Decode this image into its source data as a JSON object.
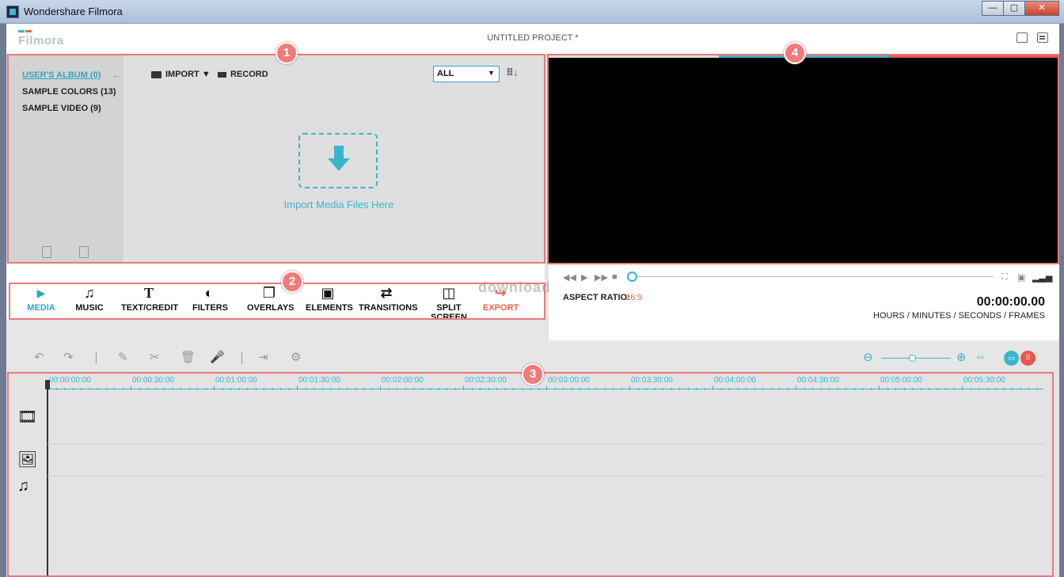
{
  "window": {
    "title": "Wondershare Filmora",
    "min": "—",
    "max": "▢",
    "close": "✕"
  },
  "app": {
    "logo_text": "Filmora",
    "project_title": "UNTITLED PROJECT *"
  },
  "library": {
    "albums": [
      {
        "label": "USER'S ALBUM (0)",
        "active": true
      },
      {
        "label": "SAMPLE COLORS (13)",
        "active": false
      },
      {
        "label": "SAMPLE VIDEO (9)",
        "active": false
      }
    ],
    "import_label": "IMPORT ▼",
    "record_label": "RECORD",
    "filter_value": "ALL",
    "drop_text": "Import Media Files Here"
  },
  "categories": [
    {
      "label": "MEDIA",
      "icon": "media-icon",
      "glyph": "▶",
      "active": true
    },
    {
      "label": "MUSIC",
      "icon": "music-icon",
      "glyph": "♫"
    },
    {
      "label": "TEXT/CREDIT",
      "icon": "text-icon",
      "glyph": "T"
    },
    {
      "label": "FILTERS",
      "icon": "filters-icon",
      "glyph": "◐"
    },
    {
      "label": "OVERLAYS",
      "icon": "overlays-icon",
      "glyph": "❐"
    },
    {
      "label": "ELEMENTS",
      "icon": "elements-icon",
      "glyph": "▣"
    },
    {
      "label": "TRANSITIONS",
      "icon": "transitions-icon",
      "glyph": "⇄"
    },
    {
      "label": "SPLIT SCREEN",
      "icon": "split-screen-icon",
      "glyph": "◫"
    },
    {
      "label": "EXPORT",
      "icon": "export-icon",
      "glyph": "↪"
    }
  ],
  "watermark": "download",
  "player": {
    "aspect_label": "ASPECT RATIO:",
    "aspect_value": "16:9",
    "timecode": "00:00:00.00",
    "timecode_label": "HOURS / MINUTES / SECONDS / FRAMES"
  },
  "timeline": {
    "ruler_ticks": [
      "00:00:00:00",
      "00:00:30:00",
      "00:01:00:00",
      "00:01:30:00",
      "00:02:00:00",
      "00:02:30:00",
      "00:03:00:00",
      "00:03:30:00",
      "00:04:00:00",
      "00:04:30:00",
      "00:05:00:00",
      "00:05:30:00"
    ]
  },
  "annotations": [
    "1",
    "2",
    "3",
    "4"
  ],
  "colors": {
    "accent": "#2ea7c2",
    "export": "#e9664e",
    "annotation": "#f17a7a"
  }
}
